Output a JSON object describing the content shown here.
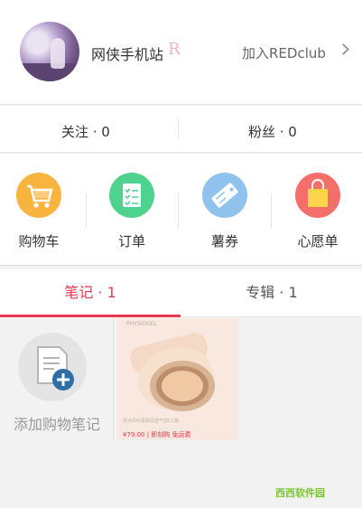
{
  "profile": {
    "nickname": "网侠手机站",
    "rank_badge": "R",
    "join_label": "加入REDclub",
    "colors": {
      "badge": "#f4b6bb"
    }
  },
  "stats": {
    "follow": "关注 · 0",
    "fans": "粉丝 · 0"
  },
  "shortcuts": [
    {
      "label": "购物车",
      "icon": "shopping-cart-icon",
      "color": "#f9b33f"
    },
    {
      "label": "订单",
      "icon": "order-checklist-icon",
      "color": "#4ed38f"
    },
    {
      "label": "薯券",
      "icon": "coupon-tag-icon",
      "color": "#8fc3ee"
    },
    {
      "label": "心愿单",
      "icon": "wishlist-bag-icon",
      "color": "#f46f6a"
    }
  ],
  "tabs": [
    {
      "label": "笔记 · 1",
      "active": true
    },
    {
      "label": "专辑 · 1",
      "active": false
    }
  ],
  "notes": {
    "add_label": "添加购物笔记",
    "product_card": {
      "brand": "PHYSIOGEL",
      "caption": "悦诗风吟菁致润透气垫CC霜",
      "price": "¥79.00 | 即刻购 免运费"
    }
  },
  "watermark": "西西软件园",
  "accent_color": "#e8384f"
}
